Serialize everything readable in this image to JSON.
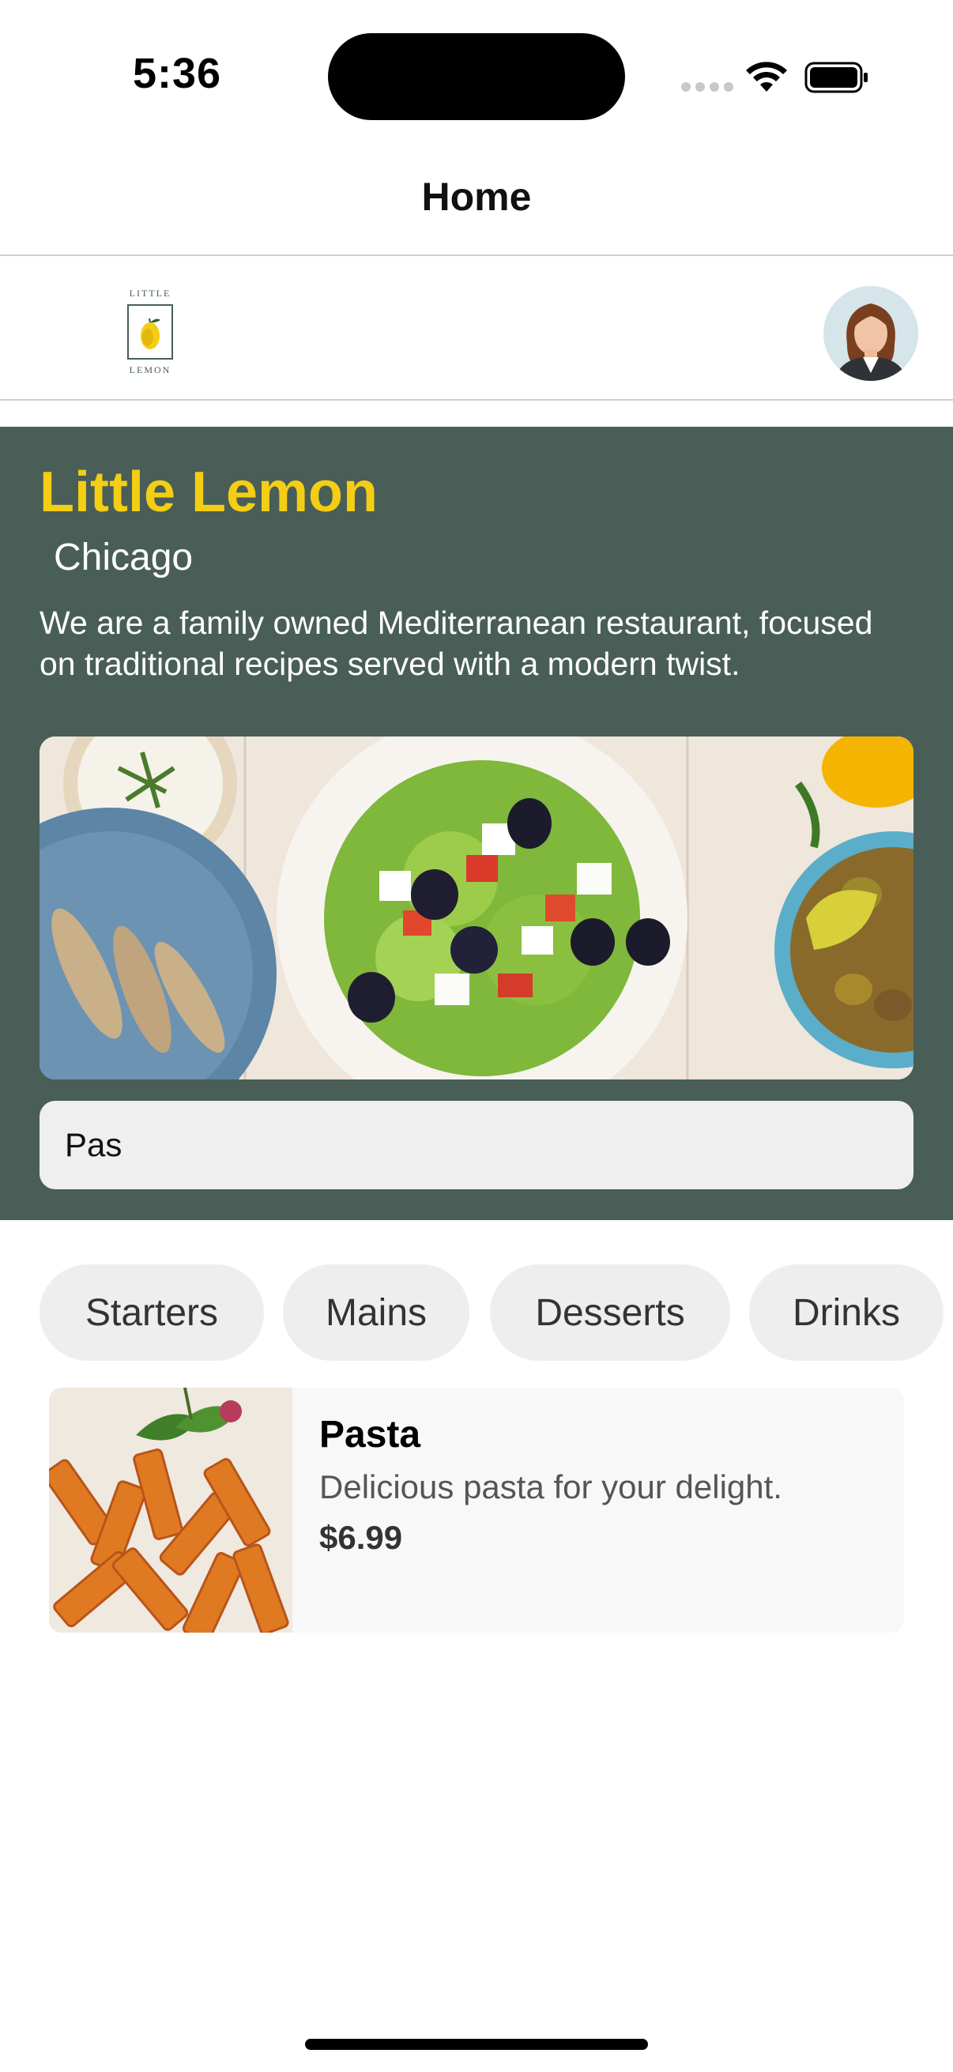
{
  "status_bar": {
    "time": "5:36",
    "icons": [
      "cellular-signal-icon",
      "wifi-icon",
      "battery-icon"
    ]
  },
  "nav": {
    "title": "Home"
  },
  "header": {
    "logo_top": "LITTLE",
    "logo_bottom": "LEMON",
    "avatar": "profile-avatar"
  },
  "hero": {
    "title": "Little Lemon",
    "city": "Chicago",
    "description": "We are a family owned Mediterranean restaurant, focused on traditional recipes served with a modern twist.",
    "image": "mediterranean-food-photo",
    "search_value": "Pas"
  },
  "categories": [
    {
      "label": "Starters"
    },
    {
      "label": "Mains"
    },
    {
      "label": "Desserts"
    },
    {
      "label": "Drinks"
    }
  ],
  "menu_items": [
    {
      "name": "Pasta",
      "description": "Delicious pasta for your delight.",
      "price": "$6.99",
      "image": "pasta-photo"
    }
  ],
  "colors": {
    "primary_green": "#495e57",
    "primary_yellow": "#f4ce14",
    "chip_background": "#eeeeee",
    "search_background": "#efefef"
  }
}
